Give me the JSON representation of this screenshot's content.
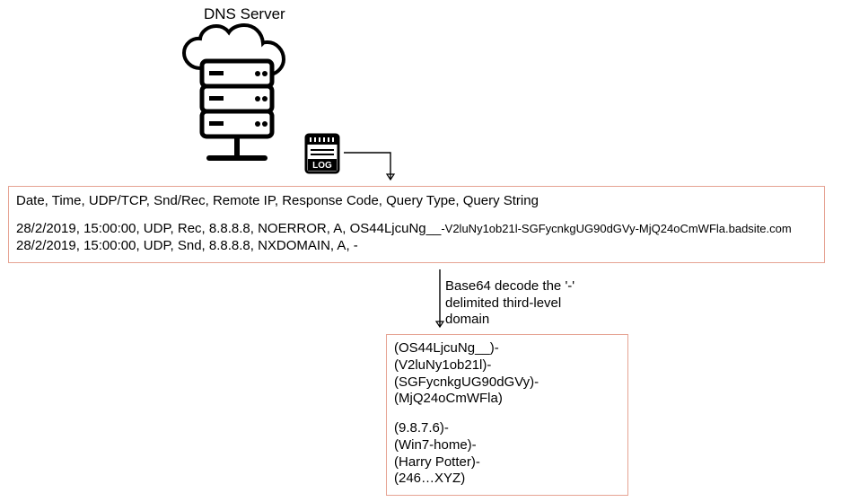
{
  "title": "DNS Server",
  "log": {
    "header": "Date, Time, UDP/TCP, Snd/Rec, Remote IP, Response Code, Query Type, Query String",
    "entries": [
      {
        "prefix": "28/2/2019, 15:00:00, UDP, Rec, 8.8.8.8, NOERROR, A, OS44LjcuNg__",
        "query": "-V2luNy1ob21l-SGFycnkgUG90dGVy-MjQ24oCmWFla.badsite.com"
      },
      {
        "prefix": "28/2/2019, 15:00:00, UDP, Snd, 8.8.8.8, NXDOMAIN, A, -",
        "query": ""
      }
    ]
  },
  "arrow_label": {
    "line1": "Base64 decode the '-'",
    "line2": "delimited third-level",
    "line3": "domain"
  },
  "decoded": {
    "enc": [
      "(OS44LjcuNg__)-",
      "(V2luNy1ob21l)-",
      "(SGFycnkgUG90dGVy)-",
      "(MjQ24oCmWFla)"
    ],
    "dec": [
      "(9.8.7.6)-",
      "(Win7-home)-",
      "(Harry Potter)-",
      "(246…XYZ)"
    ]
  },
  "icons": {
    "server": "dns-server-icon",
    "log": "log-file-icon"
  }
}
